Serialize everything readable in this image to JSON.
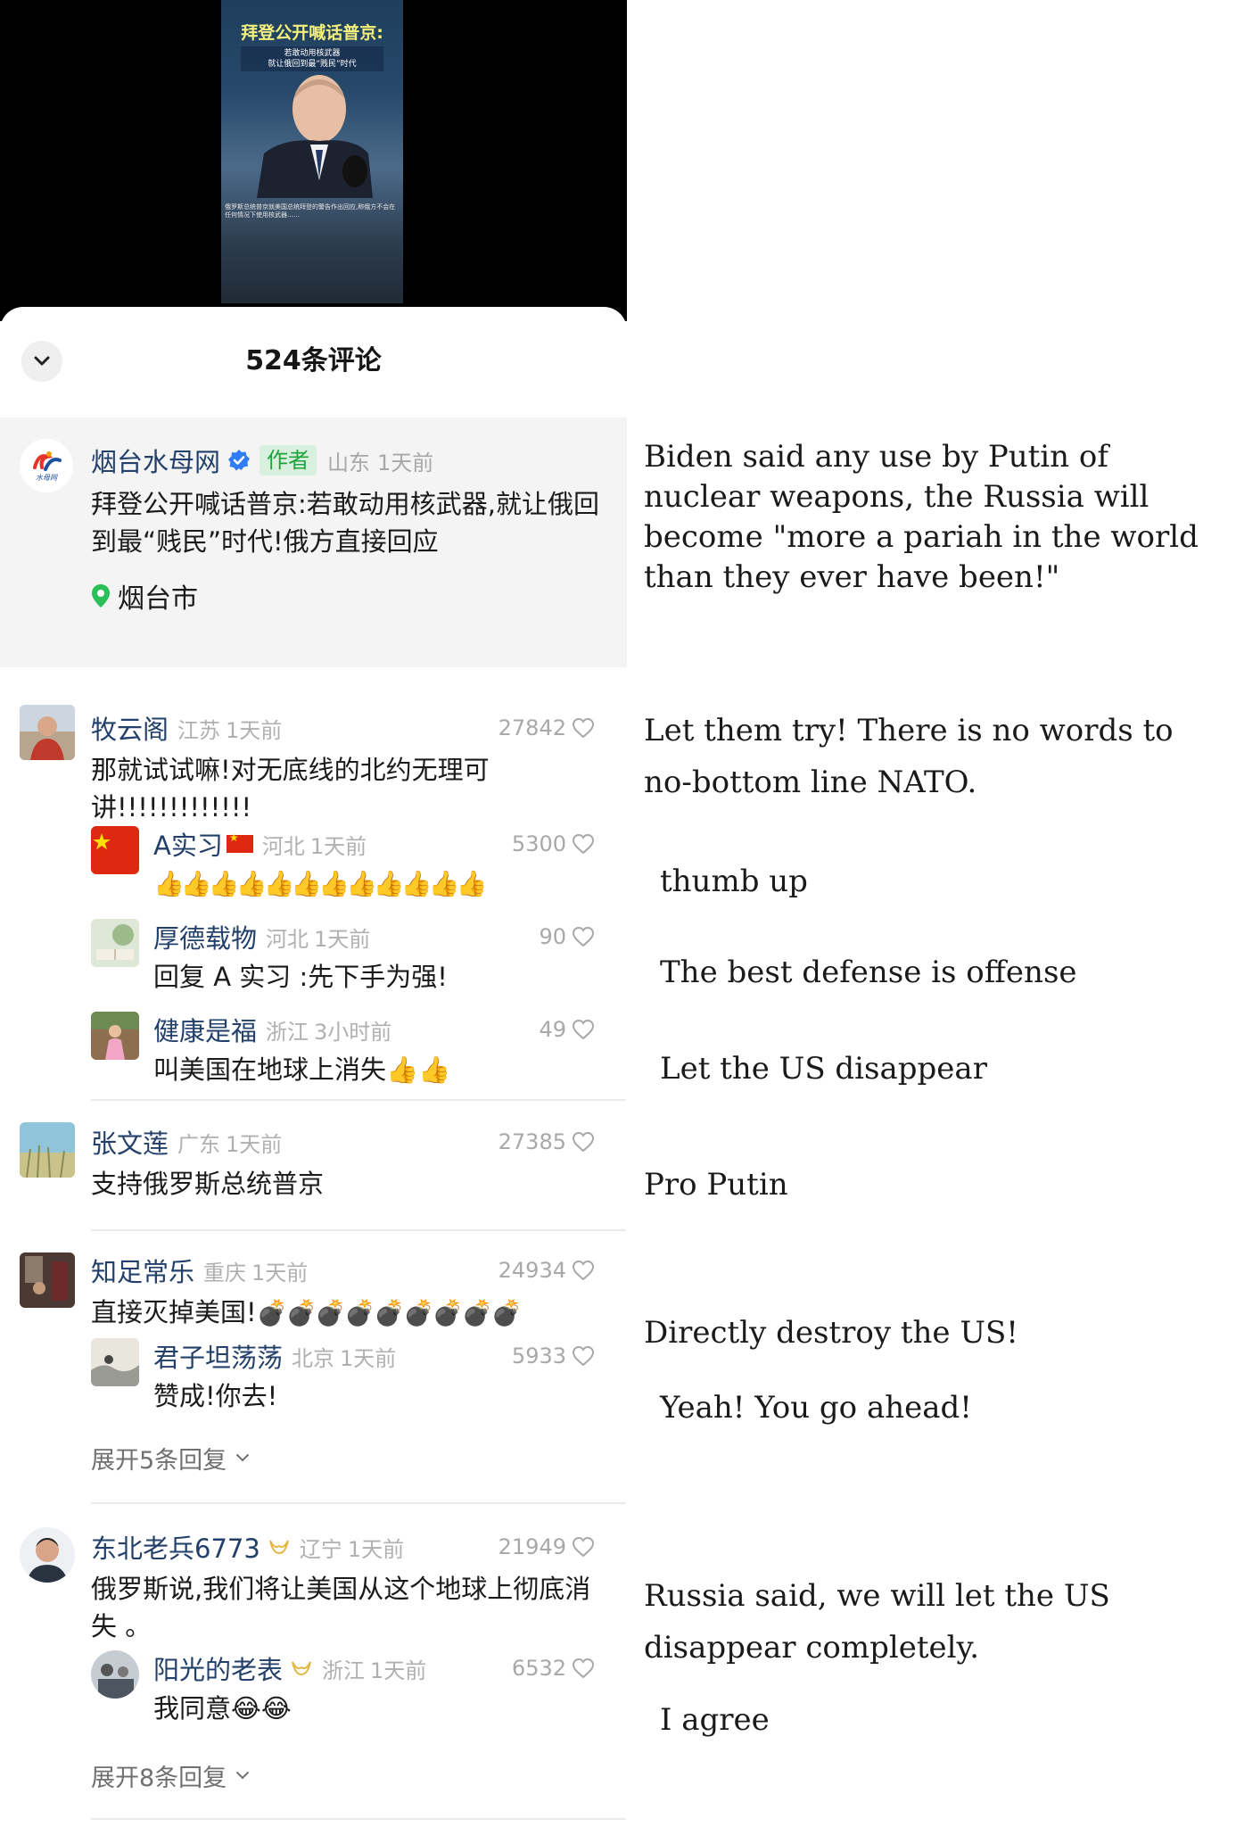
{
  "video": {
    "title": "拜登公开喊话普京:",
    "subtitle_line1": "若敢动用核武器",
    "subtitle_line2": "就让俄回到最“贱民”时代",
    "body": "俄罗斯总统普京就美国总统拜登的警告作出回应,称俄方不会在任何情况下使用核武器……"
  },
  "sheet": {
    "comment_count": "524条评论"
  },
  "author_post": {
    "name": "烟台水母网",
    "logo_text": "水母网",
    "tag": "作者",
    "region": "山东",
    "time": "1天前",
    "text": "拜登公开喊话普京:若敢动用核武器,就让俄回到最“贱民”时代!俄方直接回应",
    "location": "烟台市"
  },
  "comments": [
    {
      "name": "牧云阁",
      "region": "江苏",
      "time": "1天前",
      "likes": "27842",
      "text": "那就试试嘛!对无底线的北约无理可讲!!!!!!!!!!!!!",
      "replies": [
        {
          "name": "A实习",
          "region": "河北",
          "time": "1天前",
          "likes": "5300",
          "text": "👍👍👍👍👍👍👍👍👍👍👍👍"
        },
        {
          "name": "厚德载物",
          "region": "河北",
          "time": "1天前",
          "likes": "90",
          "text": "回复 A 实习 :先下手为强!"
        },
        {
          "name": "健康是福",
          "region": "浙江",
          "time": "3小时前",
          "likes": "49",
          "text": "叫美国在地球上消失👍👍"
        }
      ]
    },
    {
      "name": "张文莲",
      "region": "广东",
      "time": "1天前",
      "likes": "27385",
      "text": "支持俄罗斯总统普京"
    },
    {
      "name": "知足常乐",
      "region": "重庆",
      "time": "1天前",
      "likes": "24934",
      "text": "直接灭掉美国!",
      "text_emoji": "💣💣💣💣💣💣💣💣💣",
      "replies": [
        {
          "name": "君子坦荡荡",
          "region": "北京",
          "time": "1天前",
          "likes": "5933",
          "text": "赞成!你去!"
        }
      ],
      "expand": "展开5条回复"
    },
    {
      "name": "东北老兵6773",
      "region": "辽宁",
      "time": "1天前",
      "likes": "21949",
      "text": "俄罗斯说,我们将让美国从这个地球上彻底消失 。",
      "replies": [
        {
          "name": "阳光的老表",
          "region": "浙江",
          "time": "1天前",
          "likes": "6532",
          "text": "我同意😂😂"
        }
      ],
      "expand": "展开8条回复"
    }
  ],
  "translations": {
    "author": "Biden said any use by Putin of nuclear weapons, the Russia will become \"more a pariah in the world than they ever have been!\"",
    "c1": "Let them try! There is no words to no-bottom line NATO.",
    "c1r1": "thumb up",
    "c1r2": "The best defense is offense",
    "c1r3": "Let the US disappear",
    "c2": "Pro Putin",
    "c3": "Directly destroy the US!",
    "c3r1": "Yeah! You go ahead!",
    "c4": "Russia said, we will let the US disappear completely.",
    "c4r1": "I agree"
  },
  "colors": {
    "name_blue": "#23406b",
    "author_tag_bg": "#d8f0dd",
    "author_tag_fg": "#1ea33f",
    "verified": "#2f7cf6",
    "meta_gray": "#b0b0b0"
  }
}
